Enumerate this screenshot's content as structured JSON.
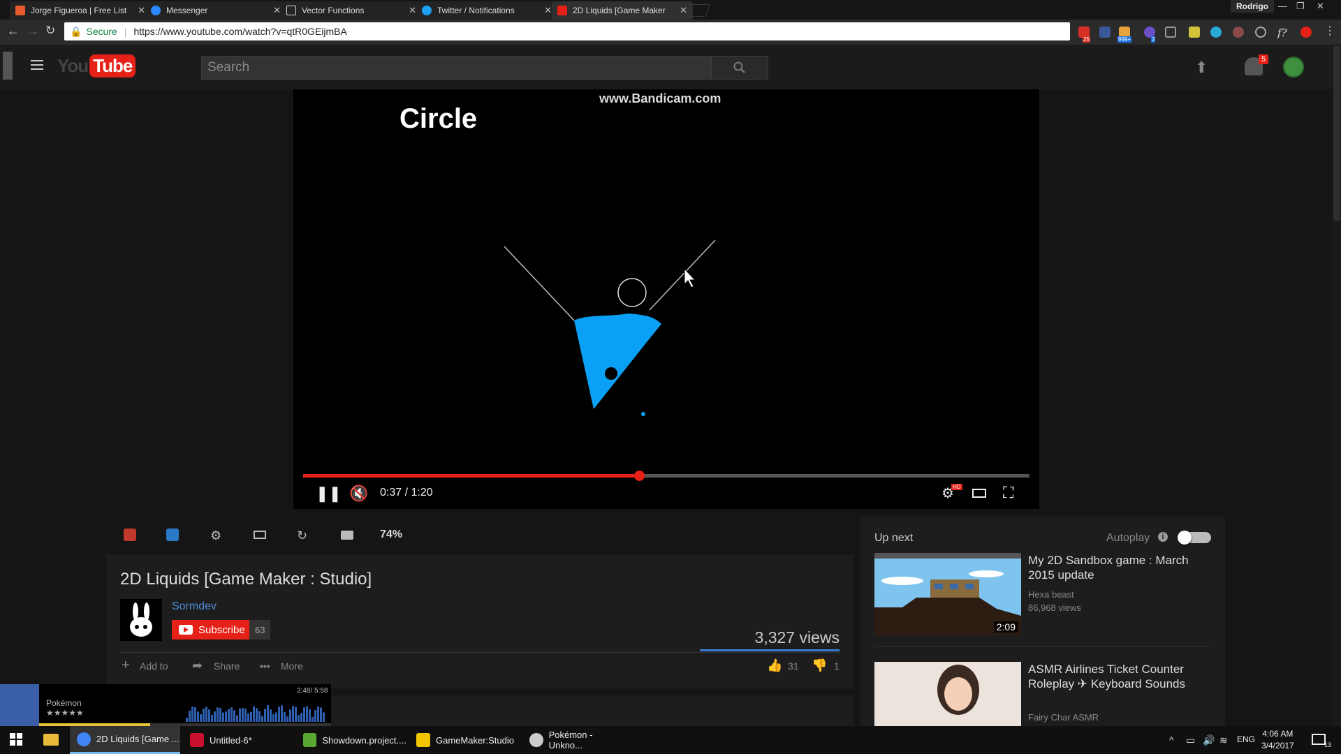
{
  "browser": {
    "tabs": [
      {
        "title": "Jorge Figueroa | Free List",
        "color": "#e8592d"
      },
      {
        "title": "Messenger",
        "color": "#2d88ff"
      },
      {
        "title": "Vector Functions",
        "color": "#dddddd"
      },
      {
        "title": "Twitter / Notifications",
        "color": "#1da1f2"
      },
      {
        "title": "2D Liquids [Game Maker",
        "color": "#e62117"
      }
    ],
    "profile": "Rodrigo",
    "secure_label": "Secure",
    "url": "https://www.youtube.com/watch?v=qtR0GEijmBA",
    "extension_badges": {
      "gmail": "25",
      "feed": "999+",
      "counter": "2"
    }
  },
  "youtube": {
    "search_placeholder": "Search",
    "notification_count": "5"
  },
  "player": {
    "watermark": "www.Bandicam.com",
    "caption": "Circle",
    "time_current": "0:37",
    "time_separator": " / ",
    "time_total": "1:20",
    "progress_fraction": 0.4625,
    "hd_badge": "HD"
  },
  "below_player": {
    "zoom": "74%"
  },
  "video": {
    "title": "2D Liquids [Game Maker : Studio]",
    "channel": "Sormdev",
    "subscribe_label": "Subscribe",
    "subscriber_count": "63",
    "views": "3,327 views",
    "add_to": "Add to",
    "share": "Share",
    "more": "More",
    "likes": "31",
    "dislikes": "1"
  },
  "sidebar": {
    "up_next": "Up next",
    "autoplay": "Autoplay",
    "videos": [
      {
        "title": "My 2D Sandbox game : March 2015 update",
        "channel": "Hexa beast",
        "views": "86,968 views",
        "duration": "2:09"
      },
      {
        "title": "ASMR Airlines Ticket Counter Roleplay ✈ Keyboard Sounds",
        "channel": "Fairy Char ASMR"
      }
    ]
  },
  "mini_player": {
    "title": "Pokémon",
    "stars": "★★★★★",
    "time": "2:48/ 5:58",
    "progress_fraction": 0.38
  },
  "taskbar": {
    "items": [
      {
        "label": "2D Liquids [Game ...",
        "color": "#4285f4"
      },
      {
        "label": "Untitled-6*",
        "color": "#c8102e"
      },
      {
        "label": "Showdown.project....",
        "color": "#5aa832"
      },
      {
        "label": "GameMaker:Studio",
        "color": "#f2c500"
      },
      {
        "label": "Pokémon - Unkno...",
        "color": "#cccccc"
      }
    ],
    "language": "ENG",
    "time": "4:06 AM",
    "date": "3/4/2017",
    "notifications": "13"
  }
}
